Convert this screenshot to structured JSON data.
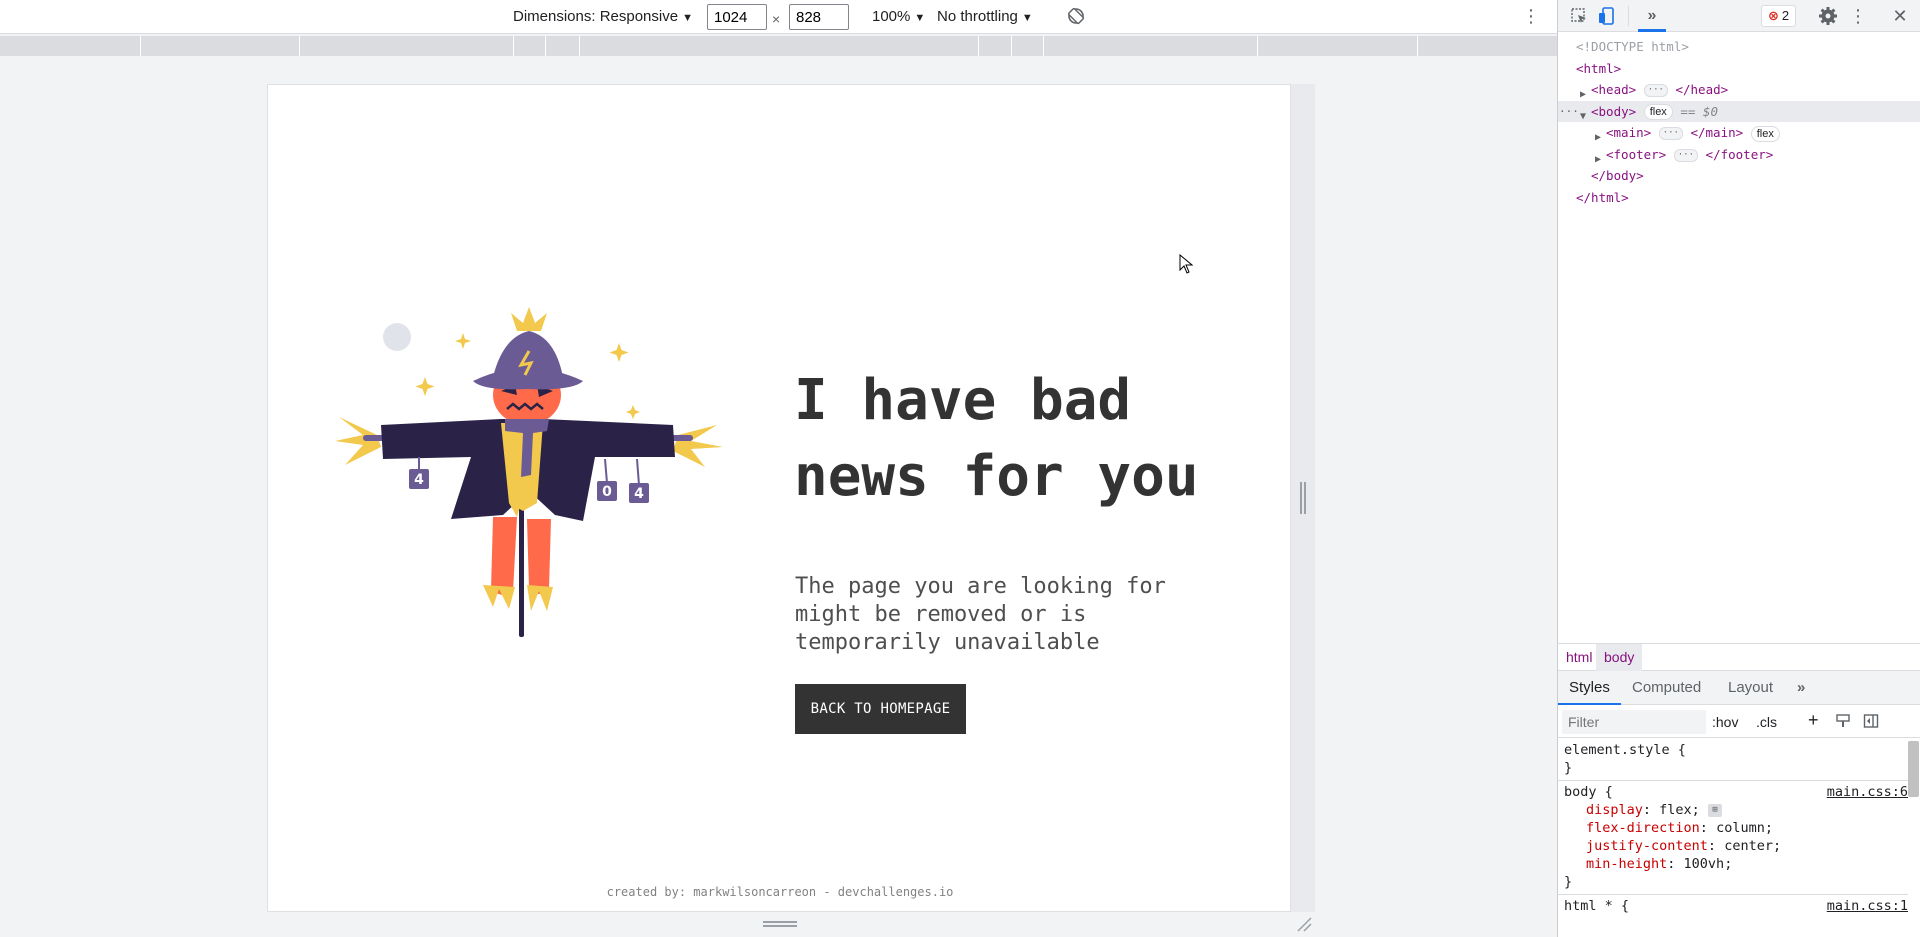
{
  "device_toolbar": {
    "dimensions_label": "Dimensions: Responsive",
    "width_value": "1024",
    "times": "×",
    "height_value": "828",
    "zoom": "100%",
    "throttling": "No throttling"
  },
  "page": {
    "heading": "I have bad news for you",
    "subtext": "The page you are looking for might be removed or is temporarily unavailable",
    "button_label": "BACK TO HOMEPAGE",
    "footer": "created by: markwilsoncarreon - devchallenges.io",
    "can_digits": [
      "4",
      "0",
      "4"
    ]
  },
  "devtools": {
    "more_tabs": "»",
    "error_count": "2",
    "dom": {
      "doctype": "<!DOCTYPE html>",
      "html_open": "<html>",
      "head_open": "<head>",
      "head_close": "</head>",
      "body_open": "<body>",
      "flex_badge": "flex",
      "selected_marker": "== $0",
      "main_open": "<main>",
      "main_close": "</main>",
      "footer_open": "<footer>",
      "footer_close": "</footer>",
      "body_close": "</body>",
      "html_close": "</html>",
      "ellipsis": "···",
      "row_menu": "···"
    },
    "breadcrumbs": [
      "html",
      "body"
    ],
    "styles_tabs": [
      "Styles",
      "Computed",
      "Layout"
    ],
    "filter_placeholder": "Filter",
    "hov": ":hov",
    "cls": ".cls",
    "plus": "+",
    "rules": {
      "element_style": "element.style {",
      "close_brace": "}",
      "body_selector": "body {",
      "body_source": "main.css:6",
      "decl_display": "display",
      "val_display": " flex;",
      "decl_flex_direction": "flex-direction",
      "val_flex_direction": " column;",
      "decl_justify": "justify-content",
      "val_justify": " center;",
      "decl_min_height": "min-height",
      "val_min_height": " 100vh;",
      "html_all_selector": "html * {",
      "html_all_source": "main.css:1"
    }
  },
  "colors": {
    "heading": "#333333",
    "button_bg": "#333333",
    "devtools_tag": "#881280",
    "devtools_prop": "#c80000",
    "devtools_accent": "#1a73e8",
    "error_red": "#d93025"
  }
}
